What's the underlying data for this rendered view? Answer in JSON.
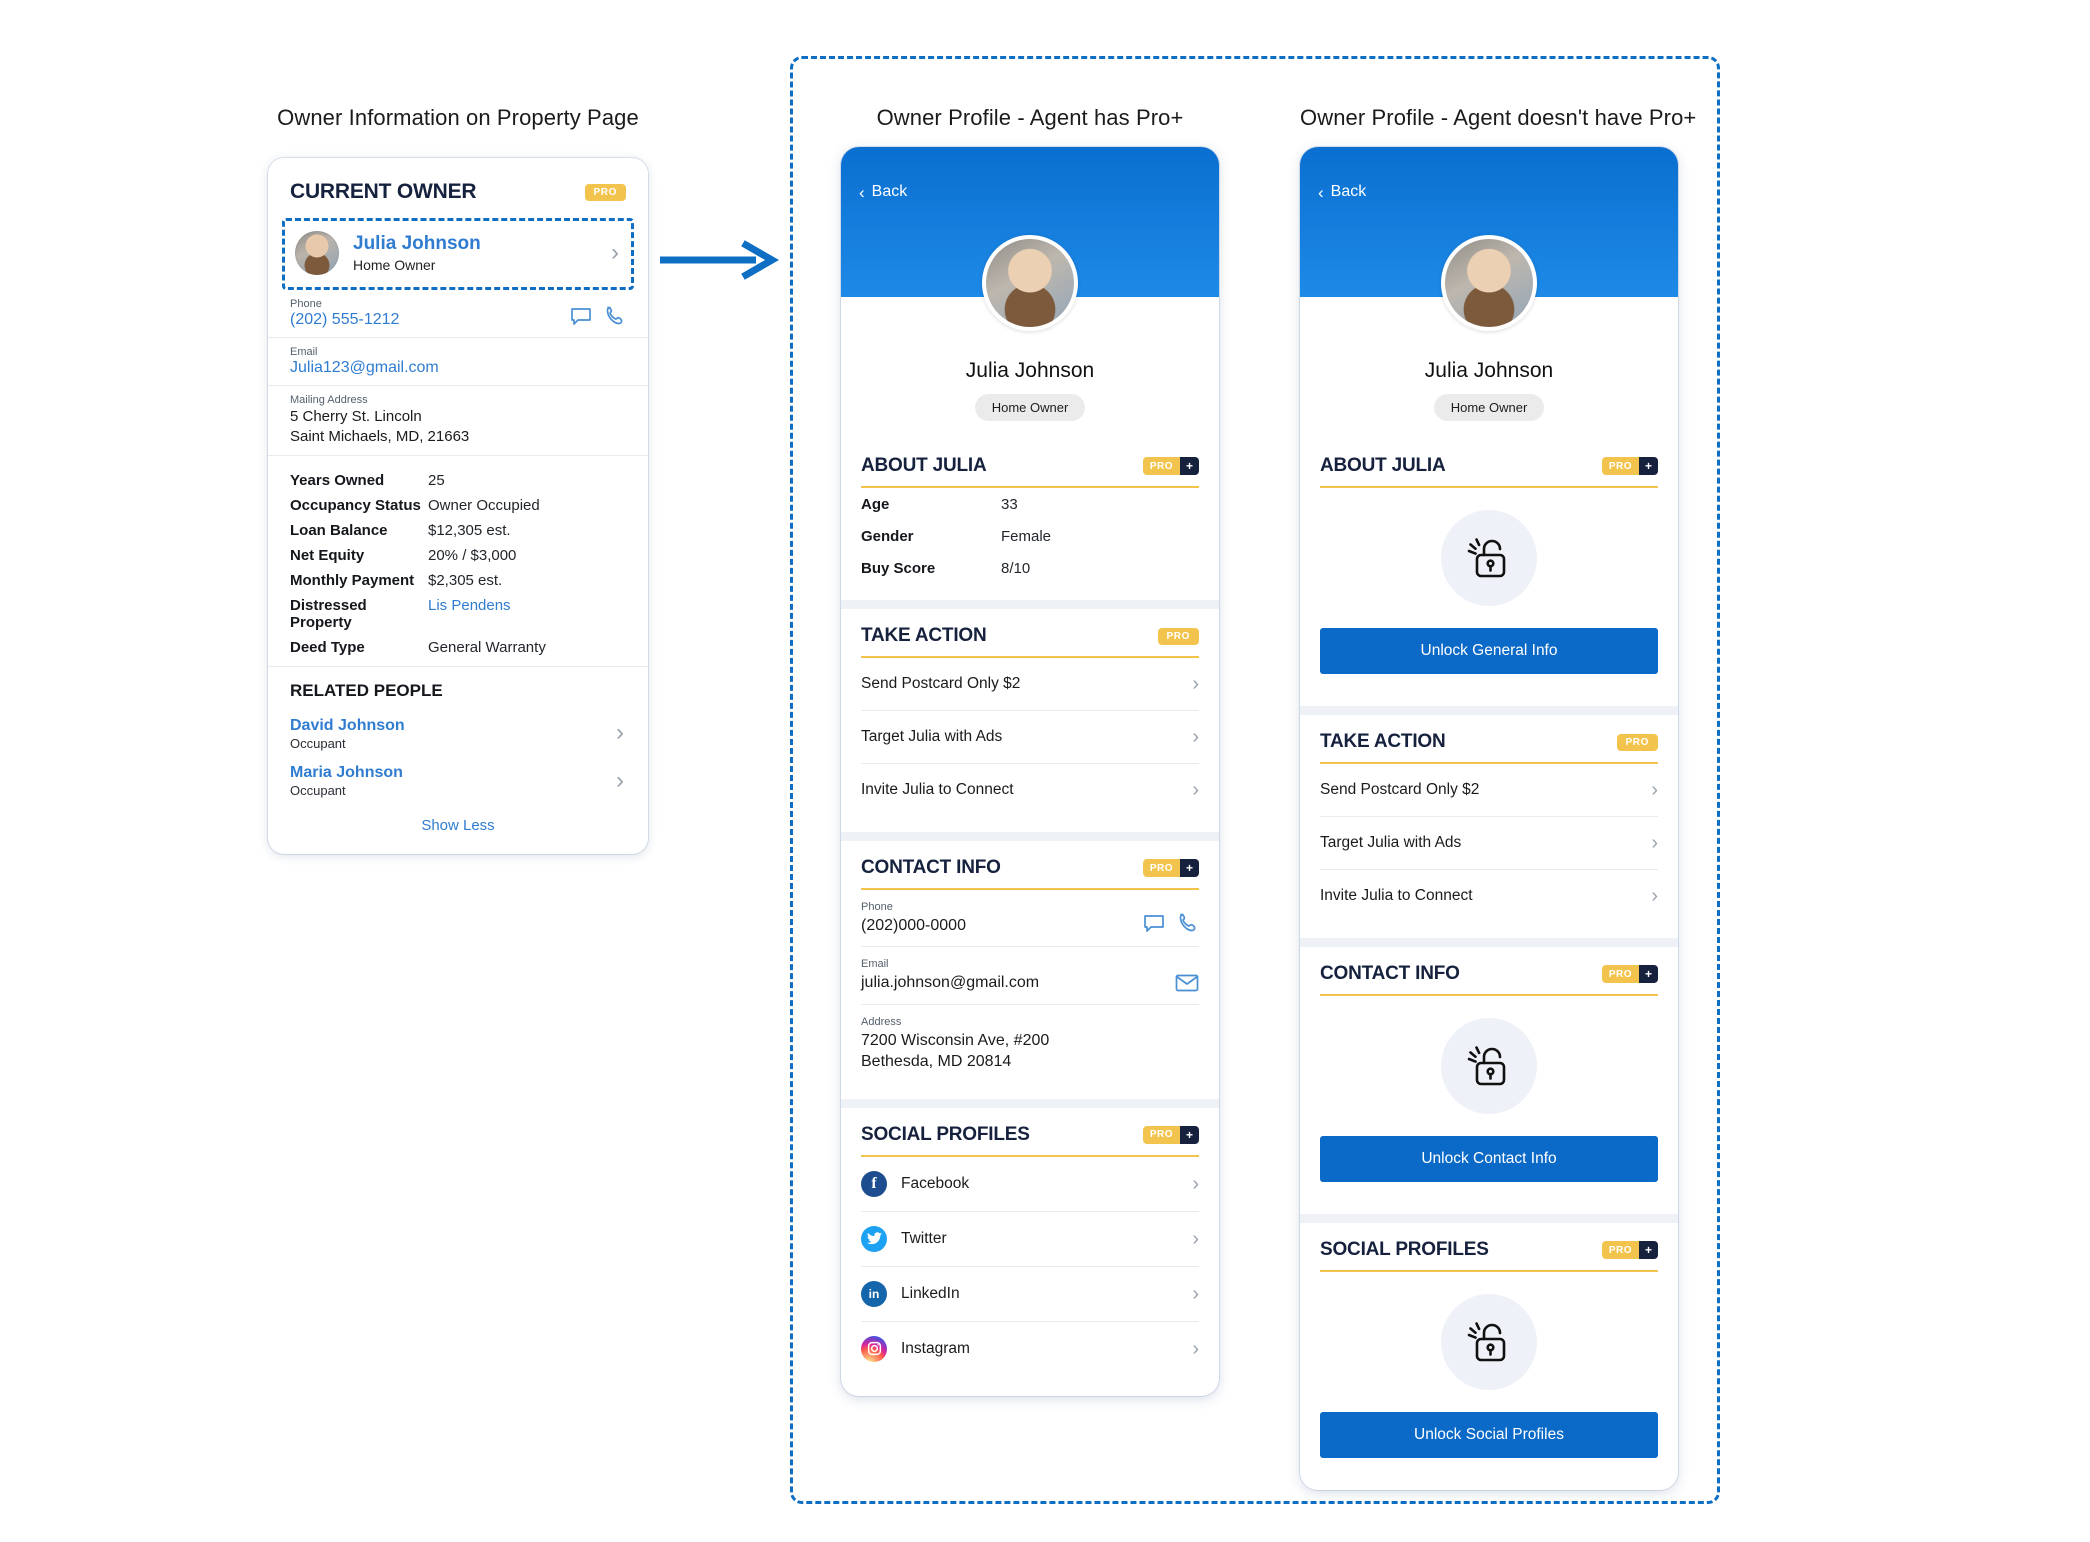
{
  "captions": {
    "left": "Owner Information on Property Page",
    "middle": "Owner Profile - Agent has Pro+",
    "right": "Owner Profile - Agent doesn't have Pro+"
  },
  "property_card": {
    "title": "CURRENT OWNER",
    "pro_badge": "PRO",
    "owner": {
      "name": "Julia Johnson",
      "role": "Home Owner"
    },
    "fields": [
      {
        "label": "Phone",
        "value": "(202) 555-1212"
      },
      {
        "label": "Email",
        "value": "Julia123@gmail.com"
      },
      {
        "label": "Mailing Address",
        "line1": "5 Cherry St. Lincoln",
        "line2": "Saint Michaels, MD, 21663"
      }
    ],
    "details": [
      {
        "key": "Years Owned",
        "value": "25"
      },
      {
        "key": "Occupancy Status",
        "value": "Owner Occupied"
      },
      {
        "key": "Loan Balance",
        "value": "$12,305 est."
      },
      {
        "key": "Net Equity",
        "value": "20% / $3,000"
      },
      {
        "key": "Monthly Payment",
        "value": "$2,305 est."
      },
      {
        "key": "Distressed Property",
        "value": "Lis Pendens",
        "link": true
      },
      {
        "key": "Deed Type",
        "value": "General Warranty"
      }
    ],
    "related_people": {
      "title": "RELATED PEOPLE",
      "people": [
        {
          "name": "David Johnson",
          "role": "Occupant"
        },
        {
          "name": "Maria Johnson",
          "role": "Occupant"
        }
      ],
      "show_less": "Show Less"
    }
  },
  "phone_unlocked": {
    "back_label": "Back",
    "profile": {
      "name": "Julia Johnson",
      "pill": "Home Owner"
    },
    "about": {
      "title": "ABOUT JULIA",
      "badge_pro": "PRO",
      "badge_plus": "+",
      "rows": [
        {
          "key": "Age",
          "value": "33"
        },
        {
          "key": "Gender",
          "value": "Female"
        },
        {
          "key": "Buy Score",
          "value": "8/10"
        }
      ]
    },
    "take_action": {
      "title": "TAKE ACTION",
      "badge_pro": "PRO",
      "items": [
        "Send Postcard Only $2",
        "Target Julia with Ads",
        "Invite Julia to Connect"
      ]
    },
    "contact_info": {
      "title": "CONTACT INFO",
      "badge_pro": "PRO",
      "badge_plus": "+",
      "phone_label": "Phone",
      "phone_value": "(202)000-0000",
      "email_label": "Email",
      "email_value": "julia.johnson@gmail.com",
      "address_label": "Address",
      "address_line1": "7200 Wisconsin Ave, #200",
      "address_line2": "Bethesda, MD 20814"
    },
    "social": {
      "title": "SOCIAL PROFILES",
      "badge_pro": "PRO",
      "badge_plus": "+",
      "items": [
        {
          "name": "Facebook",
          "color": "#1d4d8f"
        },
        {
          "name": "Twitter",
          "color": "#1da1f2"
        },
        {
          "name": "LinkedIn",
          "color": "#1565ab"
        },
        {
          "name": "Instagram",
          "color": "#c32a77"
        }
      ]
    }
  },
  "phone_locked": {
    "back_label": "Back",
    "profile": {
      "name": "Julia Johnson",
      "pill": "Home Owner"
    },
    "about": {
      "title": "ABOUT JULIA",
      "badge_pro": "PRO",
      "badge_plus": "+",
      "unlock_label": "Unlock General Info"
    },
    "take_action": {
      "title": "TAKE ACTION",
      "badge_pro": "PRO",
      "items": [
        "Send Postcard Only $2",
        "Target Julia with Ads",
        "Invite Julia to Connect"
      ]
    },
    "contact_info": {
      "title": "CONTACT INFO",
      "badge_pro": "PRO",
      "badge_plus": "+",
      "unlock_label": "Unlock Contact Info"
    },
    "social": {
      "title": "SOCIAL PROFILES",
      "badge_pro": "PRO",
      "badge_plus": "+",
      "unlock_label": "Unlock Social Profiles"
    }
  },
  "colors": {
    "accent_blue": "#0b69c7",
    "hero_blue": "#1e8ae8",
    "badge_yellow": "#f3c44d",
    "navy": "#16213e",
    "link_blue": "#2f7cd1"
  }
}
